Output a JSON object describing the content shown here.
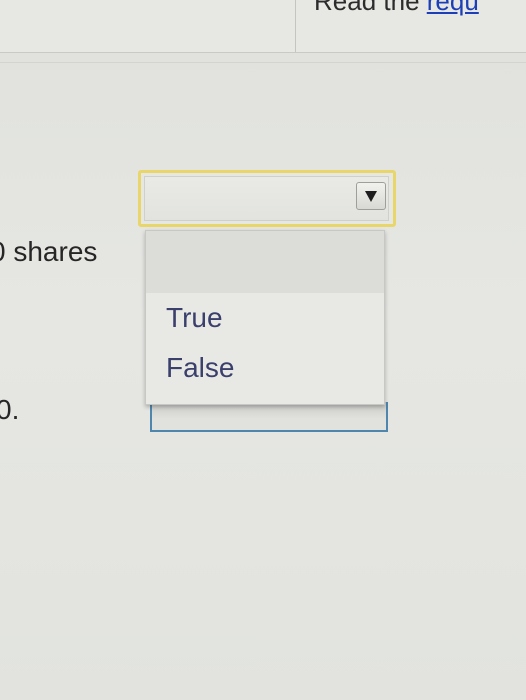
{
  "header": {
    "instruction_text": "Read the ",
    "link_text": "requ"
  },
  "question": {
    "shares_fragment": "0 shares",
    "number_fragment": "0."
  },
  "select": {
    "selected_value": "",
    "options": [
      "",
      "True",
      "False"
    ]
  },
  "colors": {
    "focus_border": "#e9d66b",
    "link": "#1c3fb8",
    "field_border": "#4f86ad"
  }
}
